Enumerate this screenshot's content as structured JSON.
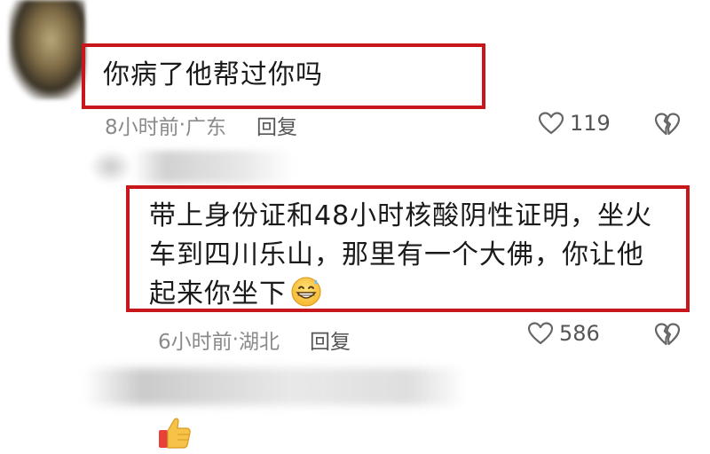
{
  "comments": [
    {
      "text": "你病了他帮过你吗",
      "time": "8小时前",
      "location": "广东",
      "reply_label": "回复",
      "likes": "119"
    },
    {
      "text": "带上身份证和48小时核酸阴性证明，坐火车到四川乐山，那里有一个大佛，你让他起来你坐下",
      "time": "6小时前",
      "location": "湖北",
      "reply_label": "回复",
      "likes": "586"
    }
  ],
  "meta_separator": " · ",
  "icons": {
    "like": "heart-outline-icon",
    "dislike": "broken-heart-icon",
    "grin_sweat": "grinning-sweat-emoji",
    "thumbs_up": "thumbs-up-emoji"
  },
  "colors": {
    "highlight": "#c8161d",
    "meta_text": "#8a8a8a",
    "body_text": "#1a1a1a"
  }
}
